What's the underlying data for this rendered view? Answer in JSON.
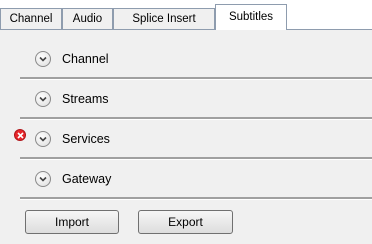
{
  "tabs": [
    {
      "label": "Channel",
      "active": false
    },
    {
      "label": "Audio",
      "active": false
    },
    {
      "label": "Splice Insert",
      "active": false
    },
    {
      "label": "Subtitles",
      "active": true
    }
  ],
  "sections": [
    {
      "label": "Channel",
      "icon": "chevron-down-icon"
    },
    {
      "label": "Streams",
      "icon": "chevron-down-icon"
    },
    {
      "label": "Services",
      "icon": "chevron-down-icon",
      "error_icon": "error-icon"
    },
    {
      "label": "Gateway",
      "icon": "chevron-down-icon"
    }
  ],
  "buttons": {
    "import_label": "Import",
    "export_label": "Export"
  },
  "colors": {
    "error": "#e8262b",
    "panel": "#f0f0f0"
  }
}
